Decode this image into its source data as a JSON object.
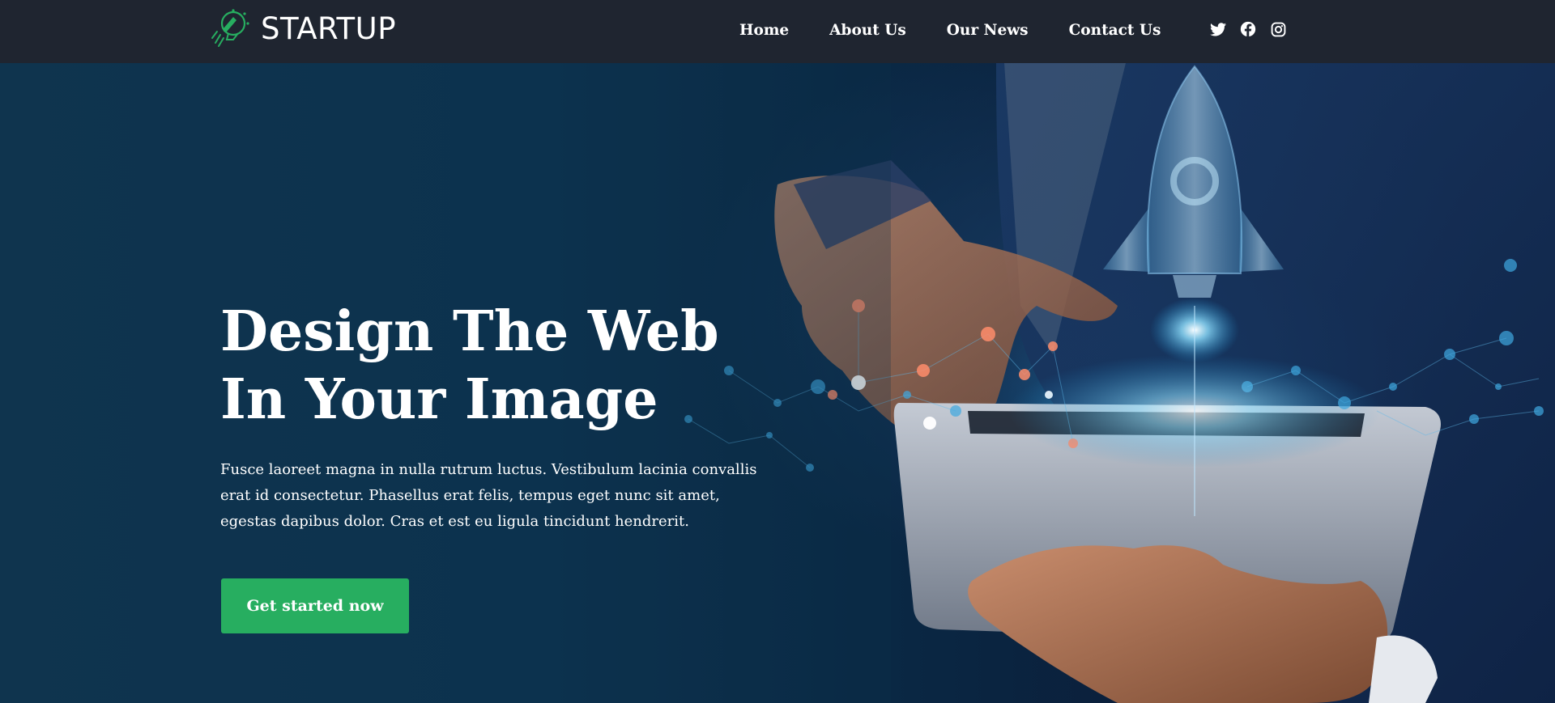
{
  "brand": {
    "name": "STARTUP",
    "logo_icon": "rocket-lightbulb-icon",
    "accent_color": "#27ae60"
  },
  "nav": {
    "items": [
      {
        "label": "Home"
      },
      {
        "label": "About Us"
      },
      {
        "label": "Our News"
      },
      {
        "label": "Contact Us"
      }
    ]
  },
  "social": {
    "icons": [
      "twitter-icon",
      "facebook-icon",
      "instagram-icon"
    ]
  },
  "hero": {
    "title_lines": [
      "Design The Web",
      "In Your Image"
    ],
    "description_lines": [
      "Fusce laoreet magna in nulla rutrum luctus. Vestibulum lacinia convallis",
      "erat id consectetur. Phasellus erat felis, tempus eget nunc sit amet,",
      "egestas dapibus dolor. Cras et est eu ligula tincidunt hendrerit."
    ],
    "cta_label": "Get started now",
    "background_image": "businessman-tablet-rocket-hologram"
  },
  "colors": {
    "header_bg": "#1f2530",
    "hero_bg": "#0d3350",
    "cta_bg": "#27ae60"
  }
}
